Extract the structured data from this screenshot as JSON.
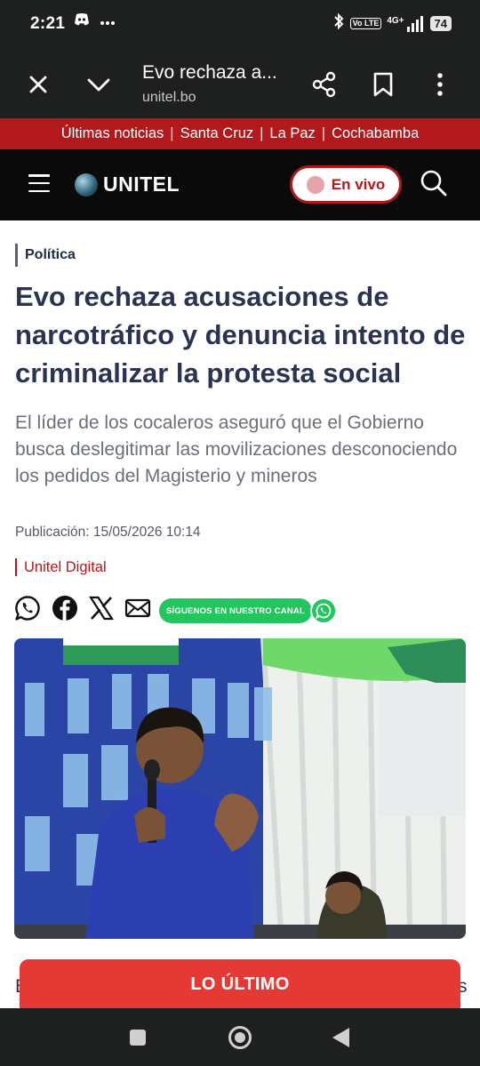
{
  "status_bar": {
    "time": "2:21",
    "left_icons": [
      "discord-icon",
      "more-dots-icon"
    ],
    "right_icons": [
      "bluetooth-icon",
      "volte-icon",
      "signal-4g-icon"
    ],
    "network": "4G+",
    "volte_label": "Vo LTE",
    "battery": "74"
  },
  "browser_tab": {
    "title": "Evo rechaza a...",
    "url": "unitel.bo"
  },
  "top_nav": {
    "items": [
      "Últimas noticias",
      "Santa Cruz",
      "La Paz",
      "Cochabamba"
    ]
  },
  "site_header": {
    "logo_text": "UNITEL",
    "live_label": "En vivo"
  },
  "article": {
    "category": "Política",
    "headline": "Evo rechaza acusaciones de narcotráfico y denuncia intento de criminalizar la protesta social",
    "summary": "El líder de los cocaleros aseguró que el Gobierno busca deslegitimar las movilizaciones desconociendo los pedidos del Magisterio y mineros",
    "published": "Publicación: 15/05/2026 10:14",
    "author": "Unitel Digital",
    "share_icons": [
      "whatsapp-icon",
      "facebook-icon",
      "x-icon",
      "email-icon"
    ],
    "follow_label": "SÍGUENOS EN NUESTRO CANAL",
    "body_start_left": "E",
    "body_start_right": "s"
  },
  "banner": {
    "label": "LO ÚLTIMO"
  },
  "colors": {
    "brand_red": "#b3191c",
    "banner_red": "#e53935",
    "whatsapp_green": "#22c55e",
    "headline_navy": "#2a3451"
  }
}
